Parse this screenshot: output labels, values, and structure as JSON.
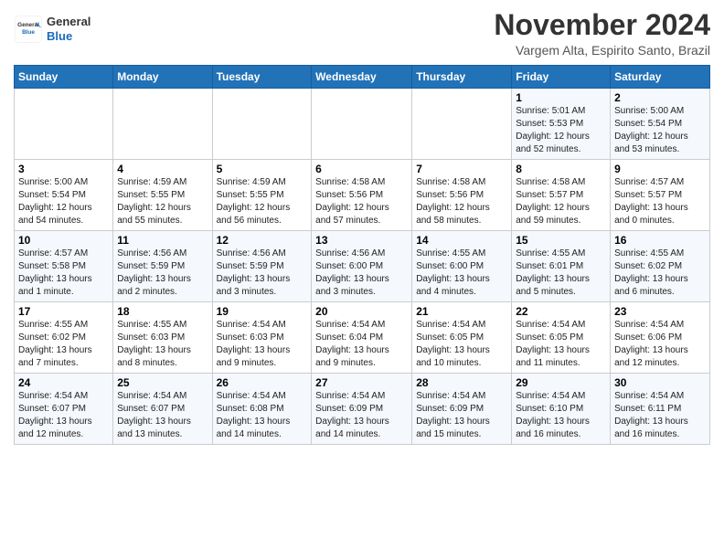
{
  "header": {
    "logo_general": "General",
    "logo_blue": "Blue",
    "month_title": "November 2024",
    "location": "Vargem Alta, Espirito Santo, Brazil"
  },
  "weekdays": [
    "Sunday",
    "Monday",
    "Tuesday",
    "Wednesday",
    "Thursday",
    "Friday",
    "Saturday"
  ],
  "weeks": [
    [
      {
        "day": "",
        "info": ""
      },
      {
        "day": "",
        "info": ""
      },
      {
        "day": "",
        "info": ""
      },
      {
        "day": "",
        "info": ""
      },
      {
        "day": "",
        "info": ""
      },
      {
        "day": "1",
        "info": "Sunrise: 5:01 AM\nSunset: 5:53 PM\nDaylight: 12 hours\nand 52 minutes."
      },
      {
        "day": "2",
        "info": "Sunrise: 5:00 AM\nSunset: 5:54 PM\nDaylight: 12 hours\nand 53 minutes."
      }
    ],
    [
      {
        "day": "3",
        "info": "Sunrise: 5:00 AM\nSunset: 5:54 PM\nDaylight: 12 hours\nand 54 minutes."
      },
      {
        "day": "4",
        "info": "Sunrise: 4:59 AM\nSunset: 5:55 PM\nDaylight: 12 hours\nand 55 minutes."
      },
      {
        "day": "5",
        "info": "Sunrise: 4:59 AM\nSunset: 5:55 PM\nDaylight: 12 hours\nand 56 minutes."
      },
      {
        "day": "6",
        "info": "Sunrise: 4:58 AM\nSunset: 5:56 PM\nDaylight: 12 hours\nand 57 minutes."
      },
      {
        "day": "7",
        "info": "Sunrise: 4:58 AM\nSunset: 5:56 PM\nDaylight: 12 hours\nand 58 minutes."
      },
      {
        "day": "8",
        "info": "Sunrise: 4:58 AM\nSunset: 5:57 PM\nDaylight: 12 hours\nand 59 minutes."
      },
      {
        "day": "9",
        "info": "Sunrise: 4:57 AM\nSunset: 5:57 PM\nDaylight: 13 hours\nand 0 minutes."
      }
    ],
    [
      {
        "day": "10",
        "info": "Sunrise: 4:57 AM\nSunset: 5:58 PM\nDaylight: 13 hours\nand 1 minute."
      },
      {
        "day": "11",
        "info": "Sunrise: 4:56 AM\nSunset: 5:59 PM\nDaylight: 13 hours\nand 2 minutes."
      },
      {
        "day": "12",
        "info": "Sunrise: 4:56 AM\nSunset: 5:59 PM\nDaylight: 13 hours\nand 3 minutes."
      },
      {
        "day": "13",
        "info": "Sunrise: 4:56 AM\nSunset: 6:00 PM\nDaylight: 13 hours\nand 3 minutes."
      },
      {
        "day": "14",
        "info": "Sunrise: 4:55 AM\nSunset: 6:00 PM\nDaylight: 13 hours\nand 4 minutes."
      },
      {
        "day": "15",
        "info": "Sunrise: 4:55 AM\nSunset: 6:01 PM\nDaylight: 13 hours\nand 5 minutes."
      },
      {
        "day": "16",
        "info": "Sunrise: 4:55 AM\nSunset: 6:02 PM\nDaylight: 13 hours\nand 6 minutes."
      }
    ],
    [
      {
        "day": "17",
        "info": "Sunrise: 4:55 AM\nSunset: 6:02 PM\nDaylight: 13 hours\nand 7 minutes."
      },
      {
        "day": "18",
        "info": "Sunrise: 4:55 AM\nSunset: 6:03 PM\nDaylight: 13 hours\nand 8 minutes."
      },
      {
        "day": "19",
        "info": "Sunrise: 4:54 AM\nSunset: 6:03 PM\nDaylight: 13 hours\nand 9 minutes."
      },
      {
        "day": "20",
        "info": "Sunrise: 4:54 AM\nSunset: 6:04 PM\nDaylight: 13 hours\nand 9 minutes."
      },
      {
        "day": "21",
        "info": "Sunrise: 4:54 AM\nSunset: 6:05 PM\nDaylight: 13 hours\nand 10 minutes."
      },
      {
        "day": "22",
        "info": "Sunrise: 4:54 AM\nSunset: 6:05 PM\nDaylight: 13 hours\nand 11 minutes."
      },
      {
        "day": "23",
        "info": "Sunrise: 4:54 AM\nSunset: 6:06 PM\nDaylight: 13 hours\nand 12 minutes."
      }
    ],
    [
      {
        "day": "24",
        "info": "Sunrise: 4:54 AM\nSunset: 6:07 PM\nDaylight: 13 hours\nand 12 minutes."
      },
      {
        "day": "25",
        "info": "Sunrise: 4:54 AM\nSunset: 6:07 PM\nDaylight: 13 hours\nand 13 minutes."
      },
      {
        "day": "26",
        "info": "Sunrise: 4:54 AM\nSunset: 6:08 PM\nDaylight: 13 hours\nand 14 minutes."
      },
      {
        "day": "27",
        "info": "Sunrise: 4:54 AM\nSunset: 6:09 PM\nDaylight: 13 hours\nand 14 minutes."
      },
      {
        "day": "28",
        "info": "Sunrise: 4:54 AM\nSunset: 6:09 PM\nDaylight: 13 hours\nand 15 minutes."
      },
      {
        "day": "29",
        "info": "Sunrise: 4:54 AM\nSunset: 6:10 PM\nDaylight: 13 hours\nand 16 minutes."
      },
      {
        "day": "30",
        "info": "Sunrise: 4:54 AM\nSunset: 6:11 PM\nDaylight: 13 hours\nand 16 minutes."
      }
    ]
  ]
}
